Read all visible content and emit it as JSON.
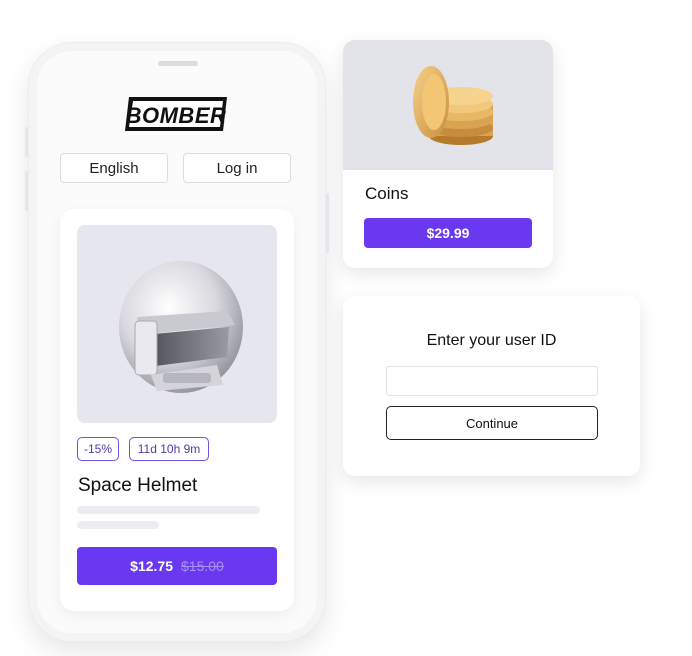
{
  "app": {
    "logo_text": "BOMBER",
    "language_button": "English",
    "login_button": "Log in"
  },
  "product": {
    "image_icon": "space-helmet",
    "discount_tag": "-15%",
    "timer_tag": "11d 10h 9m",
    "name": "Space Helmet",
    "price": "$12.75",
    "old_price": "$15.00"
  },
  "coins": {
    "image_icon": "coin-stack",
    "title": "Coins",
    "price": "$29.99"
  },
  "user_id": {
    "title": "Enter your user ID",
    "input_value": "",
    "continue_label": "Continue"
  },
  "colors": {
    "accent": "#6a38f0",
    "tag_border": "#6b53e6",
    "image_bg": "#e6e6ee"
  }
}
